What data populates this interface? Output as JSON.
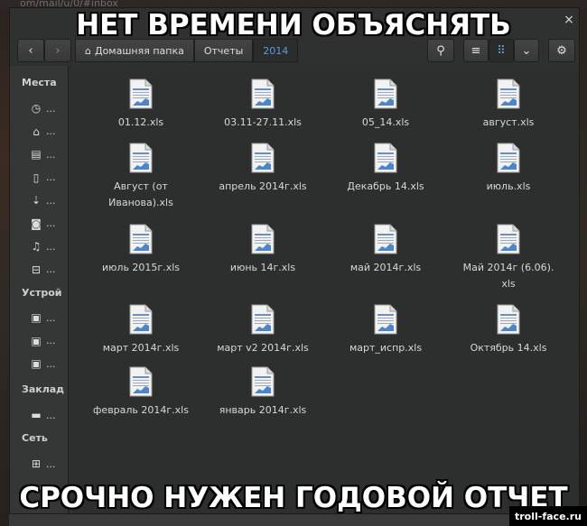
{
  "meme": {
    "top_text": "НЕТ ВРЕМЕНИ ОБЪЯСНЯТЬ",
    "bottom_text": "СРОЧНО НУЖЕН ГОДОВОЙ ОТЧЕТ",
    "watermark": "troll-face.ru"
  },
  "background": {
    "url_fragment": "om/mail/u/0/#inbox"
  },
  "window": {
    "close_glyph": "×"
  },
  "toolbar": {
    "back_glyph": "‹",
    "forward_glyph": "›",
    "search_glyph": "⚲",
    "list_glyph": "≡",
    "grid_glyph": "⠿",
    "menu_glyph": "⌄",
    "gear_glyph": "⚙"
  },
  "breadcrumbs": [
    {
      "label": "Домашняя папка",
      "icon": "home-icon"
    },
    {
      "label": "Отчеты"
    },
    {
      "label": "2014"
    }
  ],
  "sidebar": {
    "sections": [
      {
        "title": "Места",
        "items": [
          {
            "label": "...",
            "icon": "clock-icon",
            "glyph": "◷"
          },
          {
            "label": "...",
            "icon": "home-icon",
            "glyph": "⌂"
          },
          {
            "label": "...",
            "icon": "film-icon",
            "glyph": "▤"
          },
          {
            "label": "...",
            "icon": "document-icon",
            "glyph": "▯"
          },
          {
            "label": "...",
            "icon": "download-icon",
            "glyph": "⇣"
          },
          {
            "label": "...",
            "icon": "camera-icon",
            "glyph": "◙"
          },
          {
            "label": "...",
            "icon": "music-icon",
            "glyph": "♫"
          },
          {
            "label": "...",
            "icon": "trash-icon",
            "glyph": "⊟"
          }
        ]
      },
      {
        "title": "Устрой",
        "items": [
          {
            "label": "...",
            "icon": "drive-icon",
            "glyph": "▣"
          },
          {
            "label": "...",
            "icon": "drive-icon",
            "glyph": "▣"
          },
          {
            "label": "...",
            "icon": "drive-icon",
            "glyph": "▣"
          }
        ]
      },
      {
        "title": "Заклад",
        "items": [
          {
            "label": "...",
            "icon": "folder-icon",
            "glyph": "▬"
          }
        ]
      },
      {
        "title": "Сеть",
        "items": [
          {
            "label": "...",
            "icon": "network-icon",
            "glyph": "⊞"
          },
          {
            "label": "...",
            "icon": "computer-icon",
            "glyph": "▭"
          }
        ]
      }
    ]
  },
  "files": [
    [
      "01.12.xls"
    ],
    [
      "03.11-27.11.xls"
    ],
    [
      "05_14.xls"
    ],
    [
      "август.xls"
    ],
    [
      "Август (от",
      "Иванова).xls"
    ],
    [
      "апрель 2014г.xls"
    ],
    [
      "Декабрь 14.xls"
    ],
    [
      "июль.xls"
    ],
    [
      "июль 2015г.xls"
    ],
    [
      "июнь 14г.xls"
    ],
    [
      "май 2014г.xls"
    ],
    [
      "Май 2014г (6.06).",
      "xls"
    ],
    [
      "март 2014г.xls"
    ],
    [
      "март v2 2014г.xls"
    ],
    [
      "март_испр.xls"
    ],
    [
      "Октябрь 14.xls"
    ],
    [
      "февраль 2014г.xls"
    ],
    [
      "январь 2014г.xls"
    ]
  ],
  "colors": {
    "accent": "#5e9bd6",
    "window_bg": "#2f3030",
    "sidebar_bg": "#353636"
  }
}
